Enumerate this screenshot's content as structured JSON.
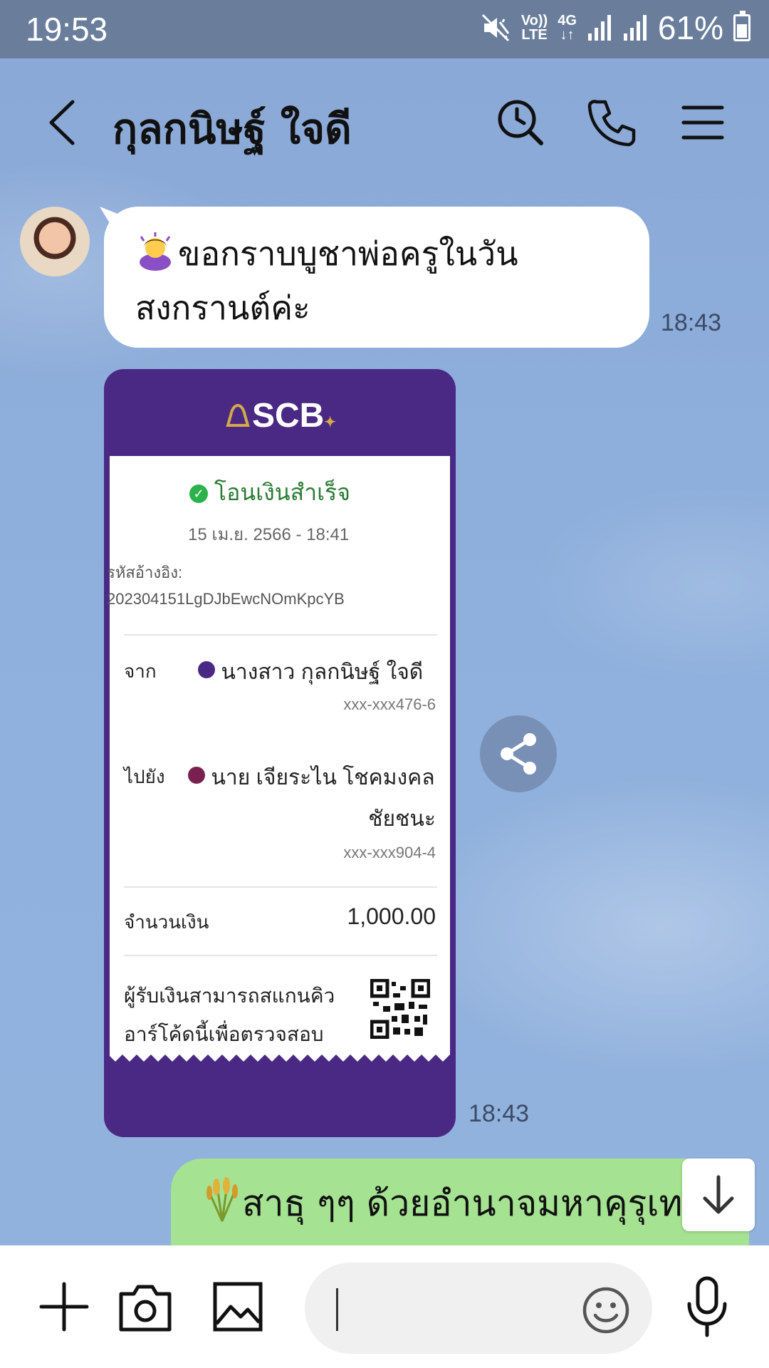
{
  "status_bar": {
    "time": "19:53",
    "volte_top": "Vo))",
    "volte_bottom": "LTE",
    "network": "4G",
    "battery": "61%"
  },
  "header": {
    "title": "กุลกนิษฐ์  ใจดี",
    "back_icon": "chevron-left",
    "icons": [
      "search-history-icon",
      "phone-icon",
      "menu-icon"
    ]
  },
  "messages": {
    "incoming_text": {
      "line1": "ขอกราบบูชาพ่อครูในวัน",
      "line2": "สงกรานต์ค่ะ",
      "time": "18:43"
    },
    "incoming_image": {
      "time": "18:43",
      "receipt": {
        "bank": "SCB",
        "status": "โอนเงินสำเร็จ",
        "datetime": "15 เม.ย. 2566 - 18:41",
        "ref_label": "รหัสอ้างอิง:",
        "ref_code": "202304151LgDJbEwcNOmKpcYB",
        "from_label": "จาก",
        "from_name": "นางสาว กุลกนิษฐ์ ใจดี",
        "from_account": "xxx-xxx476-6",
        "to_label": "ไปยัง",
        "to_name_line1": "นาย เจียระไน โชคมงคล",
        "to_name_line2": "ชัยชนะ",
        "to_account": "xxx-xxx904-4",
        "amount_label": "จำนวนเงิน",
        "amount": "1,000.00",
        "verify_line1": "ผู้รับเงินสามารถสแกนคิว",
        "verify_line2": "อาร์โค้ดนี้เพื่อตรวจสอบ"
      }
    },
    "outgoing_text": {
      "line1": "สาธุ ๆๆ ด้วยอำนาจมหาคุรุเท"
    }
  },
  "colors": {
    "background": "#8eacd9",
    "status_bar": "#6a7e9c",
    "receipt_purple": "#4a2984",
    "outgoing_bubble": "#a5e292"
  },
  "input": {
    "placeholder": ""
  }
}
